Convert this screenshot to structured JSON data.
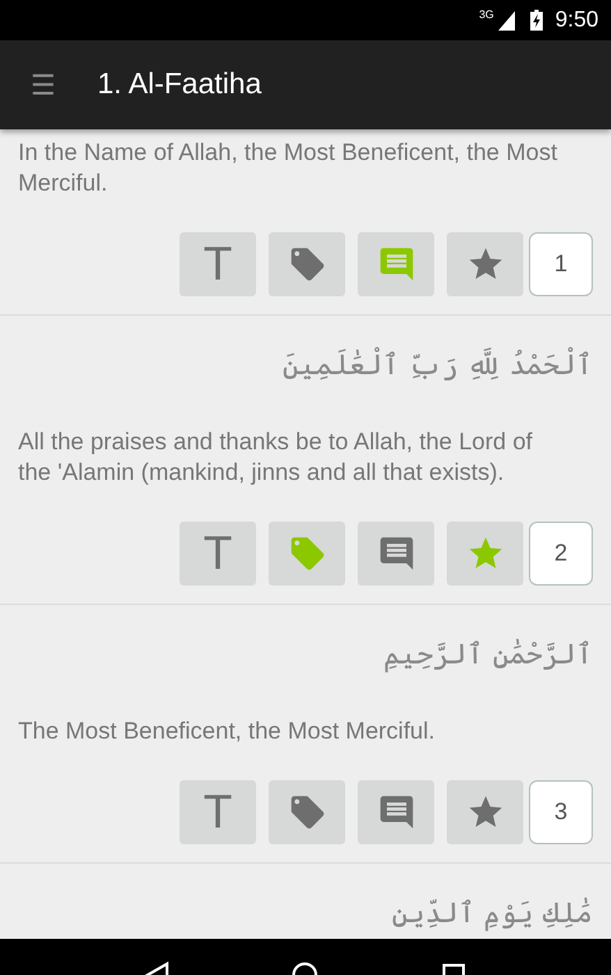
{
  "status_bar": {
    "network": "3G",
    "time": "9:50"
  },
  "toolbar": {
    "menu_icon": "☰",
    "title": "1. Al-Faatiha"
  },
  "verses": [
    {
      "translation": "In the Name of Allah, the Most Beneficent, the Most Merciful.",
      "translate_label": "T",
      "tagged": false,
      "noted": true,
      "starred": false,
      "number": "1"
    },
    {
      "arabic": "ٱلْحَمْدُ لِلَّهِ رَبِّ ٱلْعَٰلَمِينَ",
      "translation": "All the praises and thanks be to Allah, the Lord of the 'Alamin (mankind, jinns and all that exists).",
      "translate_label": "T",
      "tagged": true,
      "noted": false,
      "starred": true,
      "number": "2"
    },
    {
      "arabic": "ٱلرَّحْمَٰنِ ٱلرَّحِيمِ",
      "translation": "The Most Beneficent, the Most Merciful.",
      "translate_label": "T",
      "tagged": false,
      "noted": false,
      "starred": false,
      "number": "3"
    },
    {
      "arabic": "مَٰلِكِ يَوْمِ ٱلدِّينِ"
    }
  ]
}
